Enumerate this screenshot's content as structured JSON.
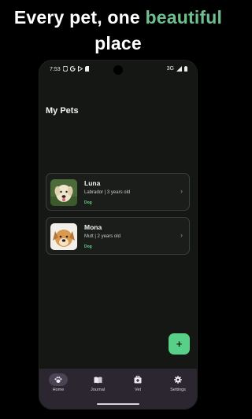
{
  "headline": {
    "part1": "Every pet, one ",
    "accent": "beautiful",
    "part2": "place"
  },
  "status_bar": {
    "time": "7:53",
    "network": "3G"
  },
  "page_title": "My Pets",
  "pets": [
    {
      "name": "Luna",
      "meta": "Labrador | 3 years old",
      "type": "Dog"
    },
    {
      "name": "Mona",
      "meta": "Mutt | 2 years old",
      "type": "Dog"
    }
  ],
  "fab": {
    "label": "+"
  },
  "nav": {
    "home": "Home",
    "journal": "Journal",
    "vet": "Vet",
    "settings": "Settings"
  },
  "colors": {
    "accent": "#58d088",
    "headline_accent": "#6fbf8e",
    "background": "#151715",
    "navbar": "#2b2630"
  }
}
